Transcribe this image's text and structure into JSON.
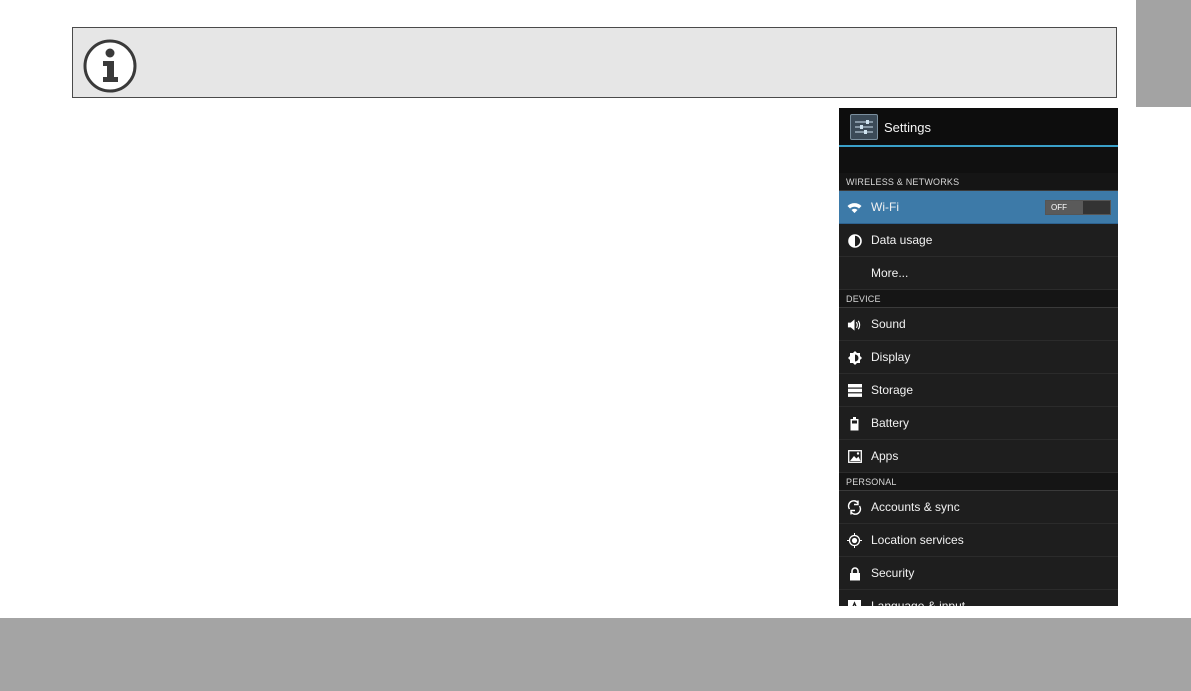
{
  "settings": {
    "title": "Settings",
    "sections": [
      {
        "header": "WIRELESS & NETWORKS",
        "items": [
          {
            "label": "Wi-Fi",
            "icon": "wifi-icon",
            "toggle": "OFF",
            "selected": true
          },
          {
            "label": "Data usage",
            "icon": "data-usage-icon"
          },
          {
            "label": "More...",
            "icon": ""
          }
        ]
      },
      {
        "header": "DEVICE",
        "items": [
          {
            "label": "Sound",
            "icon": "speaker-icon"
          },
          {
            "label": "Display",
            "icon": "brightness-icon"
          },
          {
            "label": "Storage",
            "icon": "storage-icon"
          },
          {
            "label": "Battery",
            "icon": "battery-icon"
          },
          {
            "label": "Apps",
            "icon": "apps-icon"
          }
        ]
      },
      {
        "header": "PERSONAL",
        "items": [
          {
            "label": "Accounts & sync",
            "icon": "sync-icon"
          },
          {
            "label": "Location services",
            "icon": "location-icon"
          },
          {
            "label": "Security",
            "icon": "lock-icon"
          },
          {
            "label": "Language & input",
            "icon": "keyboard-icon"
          }
        ]
      }
    ]
  },
  "colors": {
    "accent": "#3aa0c9",
    "selected_row": "#3d7aa8",
    "note_background": "#e6e6e6",
    "footer": "#a4a4a4"
  }
}
